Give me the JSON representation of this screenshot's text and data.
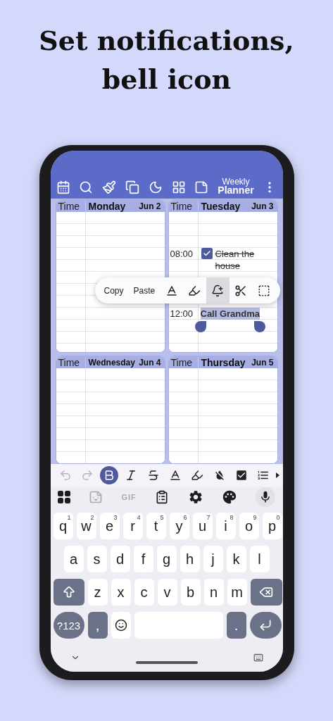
{
  "headline": [
    "Set notifications,",
    "bell icon"
  ],
  "app_title": [
    "Weekly",
    "Planner"
  ],
  "days": [
    {
      "time_label": "Time",
      "name": "Monday",
      "date": "Jun 2"
    },
    {
      "time_label": "Time",
      "name": "Tuesday",
      "date": "Jun 3",
      "entries": [
        {
          "kind": "task",
          "time": "08:00",
          "text": "Clean the house",
          "checked": true
        },
        {
          "kind": "note",
          "time": "12:00",
          "text": "Call Grandma",
          "selected": true
        }
      ]
    },
    {
      "time_label": "Time",
      "name": "Wednesday",
      "date": "Jun 4"
    },
    {
      "time_label": "Time",
      "name": "Thursday",
      "date": "Jun 5"
    }
  ],
  "popup": {
    "actions": [
      {
        "kind": "text",
        "label": "Copy",
        "selected": false
      },
      {
        "kind": "text",
        "label": "Paste",
        "selected": false
      },
      {
        "kind": "icon",
        "selected": false
      },
      {
        "kind": "icon",
        "selected": false
      },
      {
        "kind": "icon",
        "selected": true
      },
      {
        "kind": "icon",
        "selected": false
      },
      {
        "kind": "icon",
        "selected": false
      }
    ]
  },
  "format_toolbar": [
    {
      "disabled": true,
      "selected": false
    },
    {
      "disabled": true,
      "selected": false
    },
    {
      "disabled": false,
      "selected": true
    },
    {
      "disabled": false,
      "selected": false
    },
    {
      "disabled": false,
      "selected": false
    },
    {
      "disabled": false,
      "selected": false
    },
    {
      "disabled": false,
      "selected": false
    },
    {
      "disabled": false,
      "selected": false
    },
    {
      "disabled": false,
      "selected": false
    },
    {
      "disabled": false,
      "selected": false
    }
  ],
  "suggestion_bar": {
    "gif_label": "GIF"
  },
  "keyboard": [
    [
      {
        "kind": "letter",
        "label": "q",
        "hint": "1"
      },
      {
        "kind": "letter",
        "label": "w",
        "hint": "2"
      },
      {
        "kind": "letter",
        "label": "e",
        "hint": "3"
      },
      {
        "kind": "letter",
        "label": "r",
        "hint": "4"
      },
      {
        "kind": "letter",
        "label": "t",
        "hint": "5"
      },
      {
        "kind": "letter",
        "label": "y",
        "hint": "6"
      },
      {
        "kind": "letter",
        "label": "u",
        "hint": "7"
      },
      {
        "kind": "letter",
        "label": "i",
        "hint": "8"
      },
      {
        "kind": "letter",
        "label": "o",
        "hint": "9"
      },
      {
        "kind": "letter",
        "label": "p",
        "hint": "0"
      }
    ],
    [
      {
        "kind": "letter",
        "label": "a"
      },
      {
        "kind": "letter",
        "label": "s"
      },
      {
        "kind": "letter",
        "label": "d"
      },
      {
        "kind": "letter",
        "label": "f"
      },
      {
        "kind": "letter",
        "label": "g"
      },
      {
        "kind": "letter",
        "label": "h"
      },
      {
        "kind": "letter",
        "label": "j"
      },
      {
        "kind": "letter",
        "label": "k"
      },
      {
        "kind": "letter",
        "label": "l"
      }
    ],
    [
      {
        "kind": "shift"
      },
      {
        "kind": "letter",
        "label": "z"
      },
      {
        "kind": "letter",
        "label": "x"
      },
      {
        "kind": "letter",
        "label": "c"
      },
      {
        "kind": "letter",
        "label": "v"
      },
      {
        "kind": "letter",
        "label": "b"
      },
      {
        "kind": "letter",
        "label": "n"
      },
      {
        "kind": "letter",
        "label": "m"
      },
      {
        "kind": "backspace"
      }
    ],
    [
      {
        "kind": "symbols",
        "label": "?123"
      },
      {
        "kind": "punct",
        "label": ","
      },
      {
        "kind": "emoji"
      },
      {
        "kind": "space"
      },
      {
        "kind": "punct",
        "label": "."
      },
      {
        "kind": "enter"
      }
    ]
  ]
}
